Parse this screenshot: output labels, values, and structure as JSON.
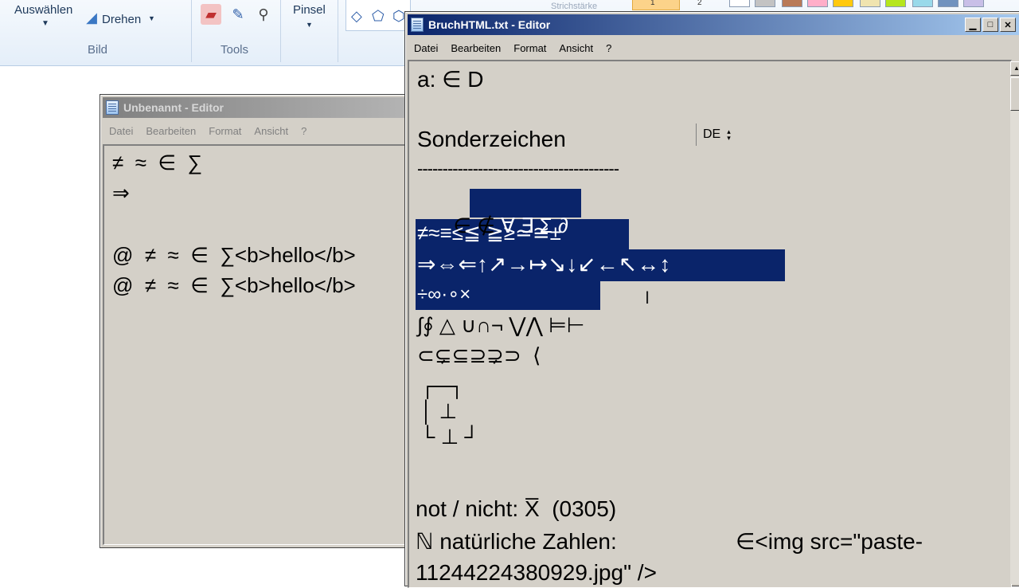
{
  "paint": {
    "select_label": "Auswählen",
    "rotate_label": "Drehen",
    "group_image": "Bild",
    "group_tools": "Tools",
    "brush_label": "Pinsel",
    "size_label": "Strichstärke",
    "color_labels": [
      "1",
      "2"
    ],
    "palette": [
      "#ffffff",
      "#c3c3c3",
      "#b97a57",
      "#ffaec9",
      "#ffc90e",
      "#efe4b0",
      "#b5e61d",
      "#99d9ea",
      "#7092be",
      "#c8bfe7"
    ]
  },
  "back_window": {
    "title": "Unbenannt - Editor",
    "menu": [
      "Datei",
      "Bearbeiten",
      "Format",
      "Ansicht",
      "?"
    ],
    "lines": [
      "≠  ≈  ∈  ∑",
      "⇒",
      "",
      "@  ≠  ≈  ∈  ∑<b>hello</b>",
      "@  ≠  ≈  ∈  ∑<b>hello</b>"
    ]
  },
  "front_window": {
    "title": "BruchHTML.txt - Editor",
    "menu": [
      "Datei",
      "Bearbeiten",
      "Format",
      "Ansicht",
      "?"
    ],
    "ime_label": "DE",
    "lines": {
      "l1": "a: ∈ D",
      "l2": "Sonderzeichen",
      "l3": "----------------------------------------",
      "l4_unsel": "∈ ∉ ",
      "l4_sel": "∀ ∃ Σ ∂",
      "l5": "≠≈≡≤≦ ≧≥≃≅±",
      "l6": "⇒⇔⇐↑↗→↦↘↓↙←↖↔↕",
      "l7": "÷∞·∘×",
      "l8": "∫∮ △ ∪∩¬ ⋁⋀ ⊨⊢",
      "l9": "⊂⊊⊆⊇⊋⊃  ⟨",
      "b1": "┌─┐",
      "b2": "│ ⊥",
      "b3": "└ ⊥ ┘",
      "l10": "not / nicht: X̅  (0305)",
      "l11_a": "ℕ natürliche Zahlen:",
      "l11_b": "∈<img src=\"paste-",
      "l12": "11244224380929.jpg\" />"
    }
  }
}
